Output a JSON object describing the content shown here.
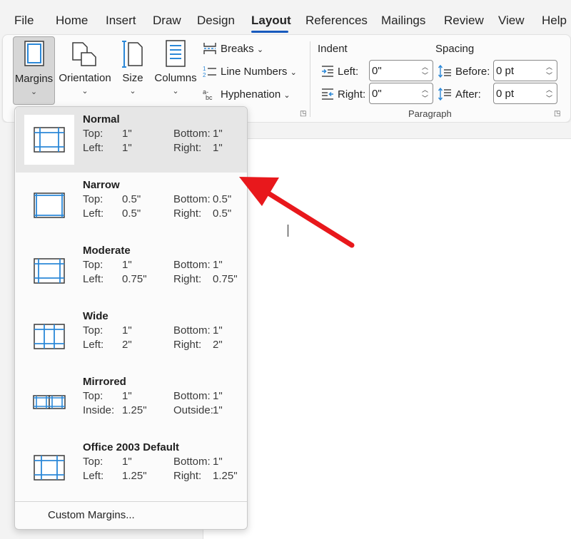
{
  "tabs": [
    "File",
    "Home",
    "Insert",
    "Draw",
    "Design",
    "Layout",
    "References",
    "Mailings",
    "Review",
    "View",
    "Help"
  ],
  "active_tab": "Layout",
  "ribbon": {
    "page_setup": {
      "margins": "Margins",
      "orientation": "Orientation",
      "size": "Size",
      "columns": "Columns",
      "breaks": "Breaks",
      "line_numbers": "Line Numbers",
      "hyphenation": "Hyphenation"
    },
    "paragraph": {
      "indent_header": "Indent",
      "spacing_header": "Spacing",
      "left_label": "Left:",
      "left_value": "0\"",
      "right_label": "Right:",
      "right_value": "0\"",
      "before_label": "Before:",
      "before_value": "0 pt",
      "after_label": "After:",
      "after_value": "0 pt",
      "group_name": "Paragraph"
    }
  },
  "margins_menu": {
    "items": [
      {
        "name": "Normal",
        "l1": "Top:",
        "v1": "1\"",
        "l2": "Bottom:",
        "v2": "1\"",
        "l3": "Left:",
        "v3": "1\"",
        "l4": "Right:",
        "v4": "1\""
      },
      {
        "name": "Narrow",
        "l1": "Top:",
        "v1": "0.5\"",
        "l2": "Bottom:",
        "v2": "0.5\"",
        "l3": "Left:",
        "v3": "0.5\"",
        "l4": "Right:",
        "v4": "0.5\""
      },
      {
        "name": "Moderate",
        "l1": "Top:",
        "v1": "1\"",
        "l2": "Bottom:",
        "v2": "1\"",
        "l3": "Left:",
        "v3": "0.75\"",
        "l4": "Right:",
        "v4": "0.75\""
      },
      {
        "name": "Wide",
        "l1": "Top:",
        "v1": "1\"",
        "l2": "Bottom:",
        "v2": "1\"",
        "l3": "Left:",
        "v3": "2\"",
        "l4": "Right:",
        "v4": "2\""
      },
      {
        "name": "Mirrored",
        "l1": "Top:",
        "v1": "1\"",
        "l2": "Bottom:",
        "v2": "1\"",
        "l3": "Inside:",
        "v3": "1.25\"",
        "l4": "Outside:",
        "v4": "1\""
      },
      {
        "name": "Office 2003 Default",
        "l1": "Top:",
        "v1": "1\"",
        "l2": "Bottom:",
        "v2": "1\"",
        "l3": "Left:",
        "v3": "1.25\"",
        "l4": "Right:",
        "v4": "1.25\""
      }
    ],
    "highlighted": "Normal",
    "custom": "Custom Margins..."
  },
  "colors": {
    "accent": "#185abd",
    "annotation_arrow": "#e8181c"
  }
}
